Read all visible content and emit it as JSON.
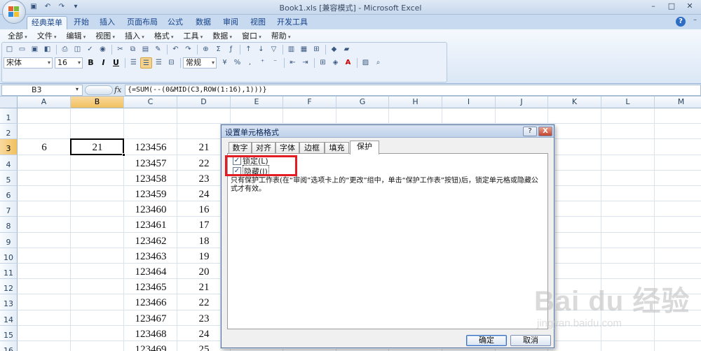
{
  "window": {
    "title": "Book1.xls [兼容模式] - Microsoft Excel",
    "controls": [
      "–",
      "□",
      "✕"
    ]
  },
  "quick_access": [
    "save-icon",
    "undo-icon",
    "redo-icon",
    "customize-icon"
  ],
  "ribbon": {
    "tabs": [
      "经典菜单",
      "开始",
      "插入",
      "页面布局",
      "公式",
      "数据",
      "审阅",
      "视图",
      "开发工具"
    ],
    "active_tab": "经典菜单",
    "menus": [
      "全部",
      "文件",
      "编辑",
      "视图",
      "插入",
      "格式",
      "工具",
      "数据",
      "窗口",
      "帮助"
    ],
    "font_name": "宋体",
    "font_size": "16",
    "number_format": "常规",
    "format_buttons": [
      "B",
      "I",
      "U"
    ]
  },
  "formula_bar": {
    "name_box": "B3",
    "fx_label": "fx",
    "formula": "{=SUM(--(0&MID(C3,ROW(1:16),1)))}"
  },
  "sheet": {
    "columns": [
      "A",
      "B",
      "C",
      "D",
      "E",
      "F",
      "G",
      "H",
      "I",
      "J",
      "K",
      "L",
      "M"
    ],
    "rows": [
      "1",
      "2",
      "3",
      "4",
      "5",
      "6",
      "7",
      "8",
      "9",
      "10",
      "11",
      "12",
      "13",
      "14",
      "15",
      "16"
    ],
    "selected_cell": "B3",
    "a3": "6",
    "b3": "21",
    "c_values": [
      "123456",
      "123457",
      "123458",
      "123459",
      "123460",
      "123461",
      "123462",
      "123463",
      "123464",
      "123465",
      "123466",
      "123467",
      "123468",
      "123469"
    ],
    "d_values": [
      "21",
      "22",
      "23",
      "24",
      "16",
      "17",
      "18",
      "19",
      "20",
      "21",
      "22",
      "23",
      "24",
      "25"
    ]
  },
  "dialog": {
    "title": "设置单元格格式",
    "help_btn": "?",
    "close_btn": "X",
    "tabs": [
      "数字",
      "对齐",
      "字体",
      "边框",
      "填充",
      "保护"
    ],
    "active_tab": "保护",
    "locked_label": "锁定(L)",
    "locked_checked": true,
    "hidden_label": "隐藏(I)",
    "hidden_checked": true,
    "note": "只有保护工作表(在“审阅”选项卡上的“更改”组中，单击“保护工作表”按钮)后，锁定单元格或隐藏公式才有效。",
    "ok_label": "确定",
    "cancel_label": "取消"
  },
  "watermark": {
    "main": "Bai du 经验",
    "sub": "jingyan.baidu.com"
  }
}
